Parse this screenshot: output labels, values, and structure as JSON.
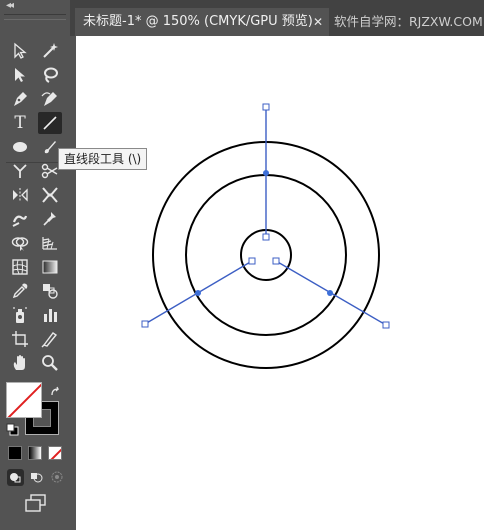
{
  "document_tabs": {
    "active_title": "未标题-1* @ 150% (CMYK/GPU 预览)",
    "close_symbol": "✕",
    "inactive_title": "软件自学网：RJZXW.COM"
  },
  "tooltip": {
    "text": "直线段工具 (\\)"
  },
  "toolbar": {
    "collapse_symbol": "◂◂",
    "text_tool_glyph": "T",
    "active_tool": "line-segment-tool",
    "fill_color": "#ffffff",
    "stroke_color": "#000000",
    "none_indicator_color": "#e02020"
  },
  "artwork": {
    "circle_stroke_color": "#000000",
    "line_color": "#3d5fc4",
    "anchor_color": "#3d6fd8",
    "concentric_circles": 3,
    "radial_lines": 3
  }
}
